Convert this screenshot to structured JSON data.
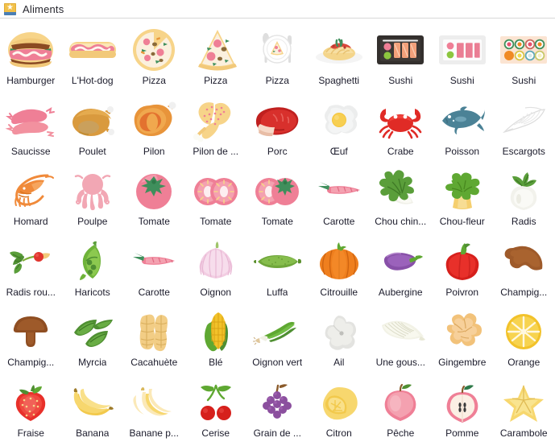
{
  "header": {
    "title": "Aliments",
    "icon": "library-star-icon",
    "icon_star_glyph": "★",
    "icon_color": "#f2c14a",
    "icon_base_color": "#4a7fb5"
  },
  "colors": {
    "background": "#ffffff",
    "text": "#1b1b2b",
    "border": "#d8d8d8"
  },
  "grid": {
    "columns": 9,
    "rows": 6
  },
  "items": [
    {
      "label": "Hamburger",
      "icon": "hamburger-icon"
    },
    {
      "label": "L'Hot-dog",
      "icon": "hotdog-icon"
    },
    {
      "label": "Pizza",
      "icon": "pizza-whole-icon"
    },
    {
      "label": "Pizza",
      "icon": "pizza-slice-icon"
    },
    {
      "label": "Pizza",
      "icon": "pizza-plate-icon"
    },
    {
      "label": "Spaghetti",
      "icon": "spaghetti-icon"
    },
    {
      "label": "Sushi",
      "icon": "sushi-dark-tray-icon"
    },
    {
      "label": "Sushi",
      "icon": "sushi-white-tray-icon"
    },
    {
      "label": "Sushi",
      "icon": "sushi-maki-box-icon"
    },
    {
      "label": "Saucisse",
      "icon": "sausage-icon"
    },
    {
      "label": "Poulet",
      "icon": "roast-chicken-icon"
    },
    {
      "label": "Pilon",
      "icon": "ham-icon"
    },
    {
      "label": "Pilon de ...",
      "icon": "drumstick-icon"
    },
    {
      "label": "Porc",
      "icon": "pork-steak-icon"
    },
    {
      "label": "Œuf",
      "icon": "fried-egg-icon"
    },
    {
      "label": "Crabe",
      "icon": "crab-icon"
    },
    {
      "label": "Poisson",
      "icon": "fish-icon"
    },
    {
      "label": "Escargots",
      "icon": "snail-shell-icon"
    },
    {
      "label": "Homard",
      "icon": "shrimp-icon"
    },
    {
      "label": "Poulpe",
      "icon": "octopus-icon"
    },
    {
      "label": "Tomate",
      "icon": "tomato-whole-icon"
    },
    {
      "label": "Tomate",
      "icon": "tomato-halves-icon"
    },
    {
      "label": "Tomate",
      "icon": "tomato-half-and-whole-icon"
    },
    {
      "label": "Carotte",
      "icon": "carrot-icon"
    },
    {
      "label": "Chou chin...",
      "icon": "bok-choy-icon"
    },
    {
      "label": "Chou-fleur",
      "icon": "broccoli-icon"
    },
    {
      "label": "Radis",
      "icon": "white-radish-icon"
    },
    {
      "label": "Radis rou...",
      "icon": "red-radish-icon"
    },
    {
      "label": "Haricots",
      "icon": "pea-pod-icon"
    },
    {
      "label": "Carotte",
      "icon": "carrot-pink-icon"
    },
    {
      "label": "Oignon",
      "icon": "onion-icon"
    },
    {
      "label": "Luffa",
      "icon": "luffa-icon"
    },
    {
      "label": "Citrouille",
      "icon": "pumpkin-icon"
    },
    {
      "label": "Aubergine",
      "icon": "eggplant-icon"
    },
    {
      "label": "Poivron",
      "icon": "bell-pepper-icon"
    },
    {
      "label": "Champig...",
      "icon": "mushroom-cap-icon"
    },
    {
      "label": "Champig...",
      "icon": "mushroom-icon"
    },
    {
      "label": "Myrcia",
      "icon": "bay-leaves-icon"
    },
    {
      "label": "Cacahuète",
      "icon": "peanut-icon"
    },
    {
      "label": "Blé",
      "icon": "corn-icon"
    },
    {
      "label": "Oignon vert",
      "icon": "scallion-icon"
    },
    {
      "label": "Ail",
      "icon": "garlic-icon"
    },
    {
      "label": "Une gous...",
      "icon": "garlic-clove-icon"
    },
    {
      "label": "Gingembre",
      "icon": "ginger-icon"
    },
    {
      "label": "Orange",
      "icon": "orange-slice-icon"
    },
    {
      "label": "Fraise",
      "icon": "strawberry-icon"
    },
    {
      "label": "Banana",
      "icon": "bananas-icon"
    },
    {
      "label": "Banane p...",
      "icon": "peeled-banana-icon"
    },
    {
      "label": "Cerise",
      "icon": "cherries-icon"
    },
    {
      "label": "Grain de ...",
      "icon": "grapes-icon"
    },
    {
      "label": "Citron",
      "icon": "lemon-icon"
    },
    {
      "label": "Pêche",
      "icon": "peach-icon"
    },
    {
      "label": "Pomme",
      "icon": "apple-half-icon"
    },
    {
      "label": "Carambole",
      "icon": "starfruit-icon"
    }
  ]
}
